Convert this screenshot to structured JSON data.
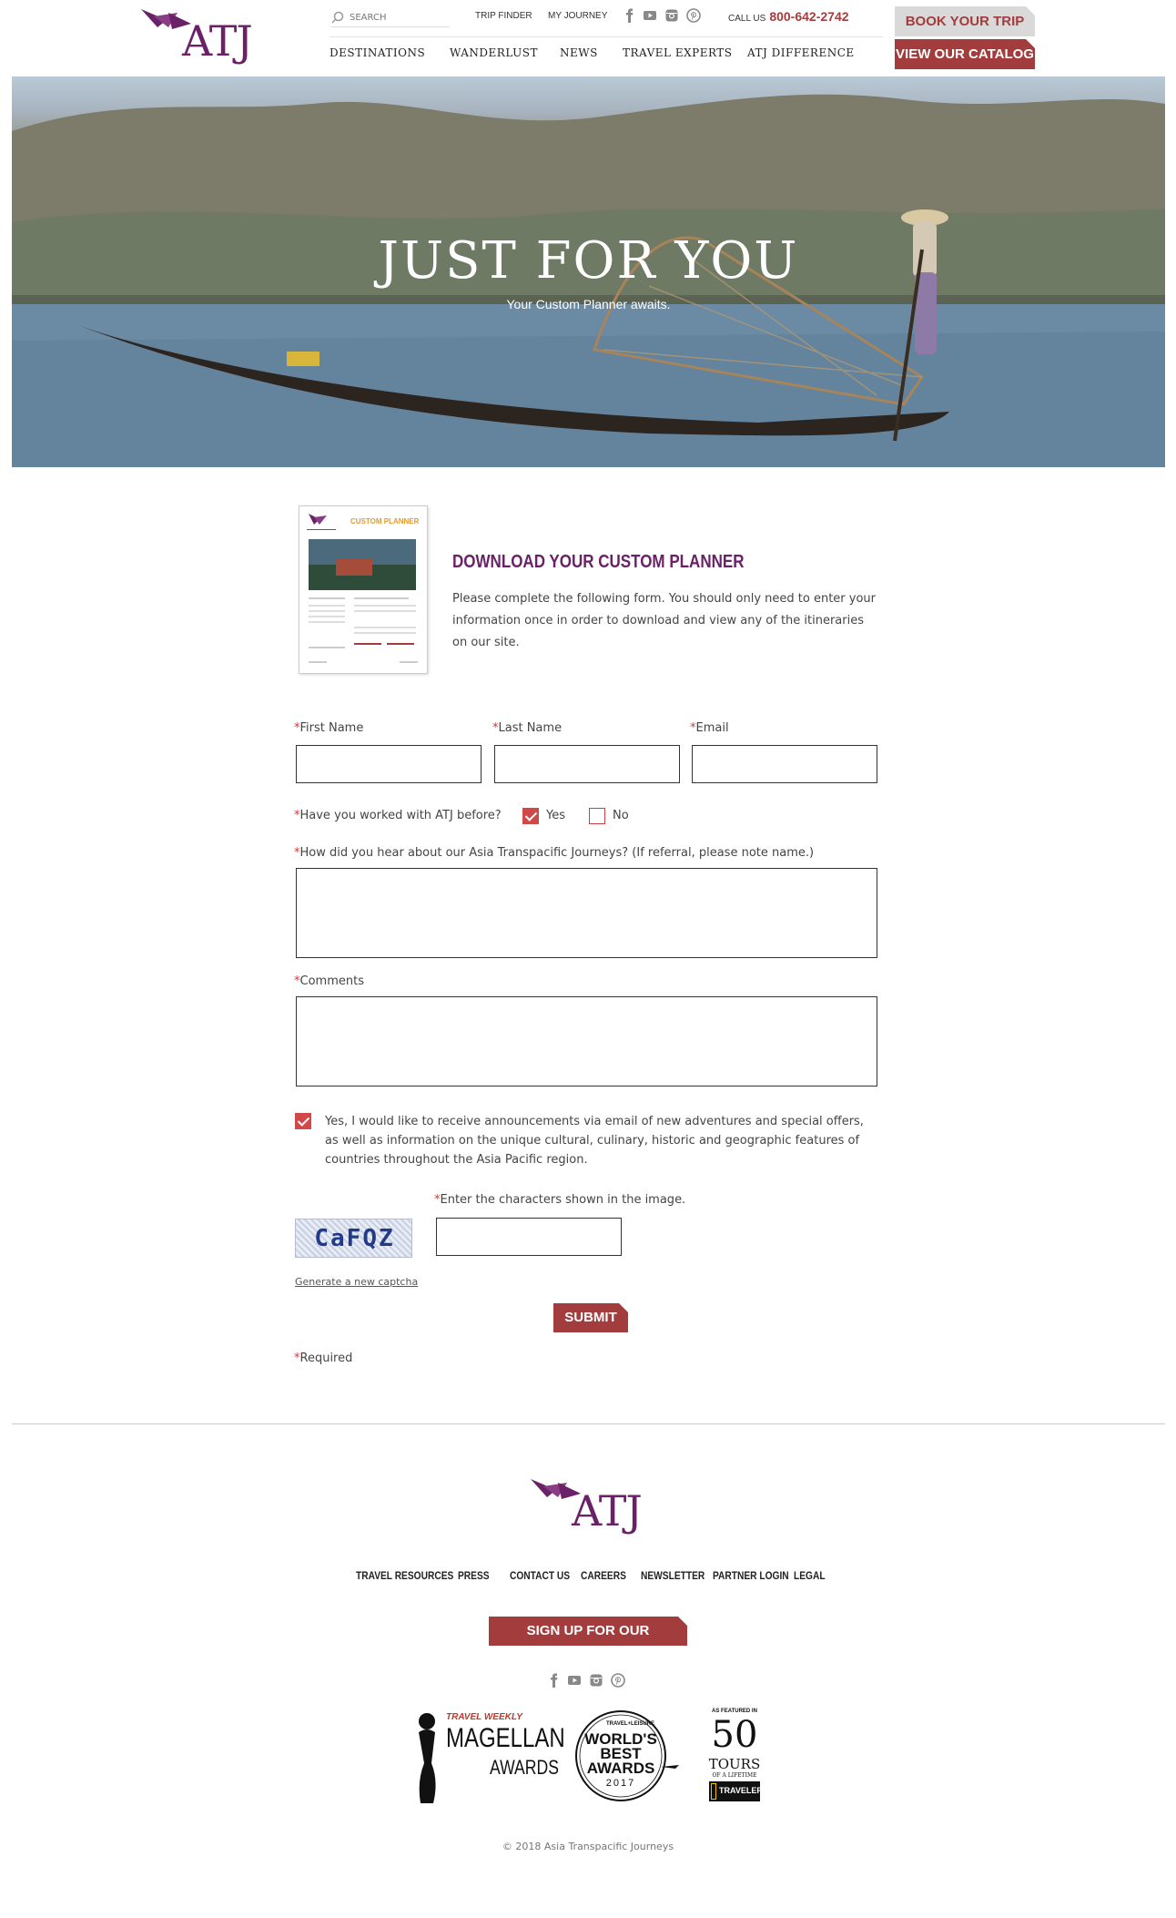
{
  "brand": {
    "logo_text": "ATJ",
    "purple": "#6a2167",
    "red": "#a33c3c"
  },
  "header": {
    "search_placeholder": "SEARCH",
    "util_links": [
      "TRIP FINDER",
      "MY JOURNEY"
    ],
    "call_label": "CALL US",
    "phone": "800-642-2742",
    "book_label": "BOOK YOUR TRIP",
    "catalog_label": "VIEW OUR CATALOG",
    "nav": [
      "DESTINATIONS",
      "WANDERLUST",
      "NEWS",
      "TRAVEL EXPERTS",
      "ATJ DIFFERENCE"
    ],
    "social_icons": [
      "facebook-icon",
      "youtube-icon",
      "instagram-icon",
      "pinterest-icon"
    ]
  },
  "hero": {
    "title": "JUST FOR YOU",
    "subtitle": "Your Custom Planner awaits."
  },
  "intro": {
    "thumb_title": "CUSTOM PLANNER",
    "title": "DOWNLOAD YOUR CUSTOM PLANNER",
    "text": "Please complete the following form. You should only need to enter your information once in order to download and view any of the itineraries on our site."
  },
  "form": {
    "first_name_label": "First Name",
    "last_name_label": "Last Name",
    "email_label": "Email",
    "worked_label": "Have you worked with ATJ before?",
    "yes_label": "Yes",
    "no_label": "No",
    "worked_value": "Yes",
    "hear_label": "How did you hear about our Asia Transpacific Journeys? (If referral, please note name.)",
    "comments_label": "Comments",
    "consent_checked": true,
    "consent_text": "Yes, I would like to receive announcements via email of new adventures and special offers, as well as information on the unique cultural, culinary, historic and geographic features of countries throughout the Asia Pacific region.",
    "captcha_label": "Enter the characters shown in the image.",
    "captcha_code": "CaFQZ",
    "captcha_link": "Generate a new captcha",
    "submit_label": "SUBMIT",
    "required_note": "Required"
  },
  "footer": {
    "nav": [
      "TRAVEL RESOURCES",
      "PRESS",
      "CONTACT US",
      "CAREERS",
      "NEWSLETTER",
      "PARTNER LOGIN",
      "LEGAL"
    ],
    "newsletter_label": "SIGN UP FOR OUR NEWSLETTER",
    "awards": {
      "magellan_top": "TRAVEL WEEKLY",
      "magellan_main": "MAGELLAN",
      "magellan_sub": "AWARDS",
      "wb_top": "TRAVEL+LEISURE",
      "wb_line1": "WORLD'S",
      "wb_line2": "BEST",
      "wb_line3": "AWARDS",
      "wb_year": "2017",
      "ng_top": "AS FEATURED IN",
      "ng_num": "50",
      "ng_tours": "TOURS",
      "ng_life": "OF A LIFETIME",
      "ng_brand": "TRAVELER"
    },
    "copyright": "© 2018 Asia Transpacific Journeys"
  }
}
